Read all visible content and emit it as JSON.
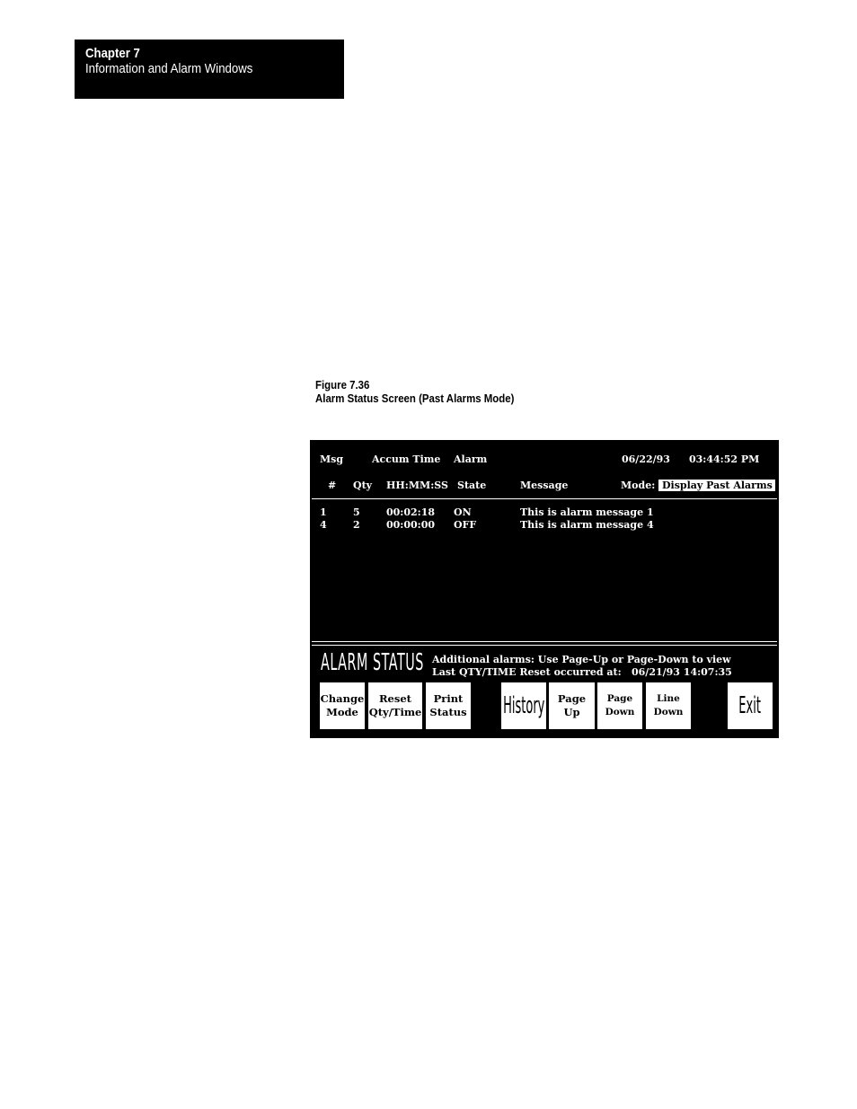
{
  "header": {
    "chapter": "Chapter 7",
    "title": "Information and Alarm Windows"
  },
  "figure": {
    "number": "Figure 7.36",
    "caption": "Alarm Status Screen (Past Alarms Mode)"
  },
  "screen": {
    "date": "06/22/93",
    "time": "03:44:52 PM",
    "columns_row1": {
      "msg": "Msg",
      "accum_time": "Accum Time",
      "alarm": "Alarm"
    },
    "columns_row2": {
      "num": "#",
      "qty": "Qty",
      "hhmmss": "HH:MM:SS",
      "state": "State",
      "message": "Message"
    },
    "mode_label": "Mode:",
    "mode_value": "Display Past Alarms",
    "rows": [
      {
        "num": "1",
        "qty": "5",
        "time": "00:02:18",
        "state": "ON",
        "message": "This is alarm message 1"
      },
      {
        "num": "4",
        "qty": "2",
        "time": "00:00:00",
        "state": "OFF",
        "message": "This is alarm message 4"
      }
    ],
    "footer_title": "ALARM STATUS",
    "additional_info": "Additional alarms:  Use Page-Up or Page-Down to view",
    "last_reset_label": "Last QTY/TIME Reset occurred at:",
    "last_reset_value": "06/21/93 14:07:35",
    "buttons": {
      "change_mode": [
        "Change",
        "Mode"
      ],
      "reset": [
        "Reset",
        "Qty/Time"
      ],
      "print": [
        "Print",
        "Status"
      ],
      "history": "History",
      "page_up": [
        "Page",
        "Up"
      ],
      "page_down": [
        "Page",
        "Down"
      ],
      "line_down": [
        "Line",
        "Down"
      ],
      "exit": "Exit"
    }
  }
}
